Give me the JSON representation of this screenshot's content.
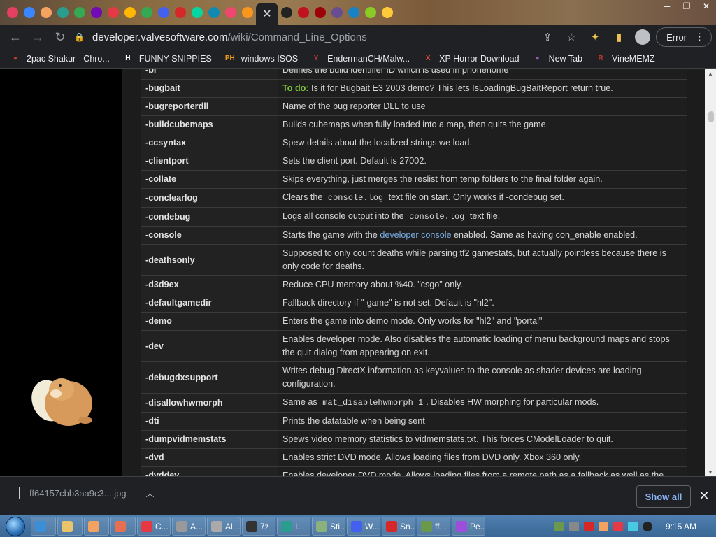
{
  "browser": {
    "tab_favicons": [
      "instagram-icon",
      "tab-icon",
      "tab-icon",
      "tab-icon",
      "chrome-icon",
      "tab-icon",
      "tab-icon",
      "tab-icon",
      "chrome-icon",
      "tab-icon",
      "tab-icon",
      "tab-icon",
      "tab-icon",
      "tab-icon",
      "tab-icon",
      "skull-icon",
      "tab-icon",
      "tab-icon",
      "tab-icon",
      "tab-icon",
      "tab-icon",
      "tab-icon"
    ],
    "active_tab_close": "✕",
    "url_domain": "developer.valvesoftware.com",
    "url_path": "/wiki/Command_Line_Options",
    "error_label": "Error",
    "bookmarks": [
      {
        "label": "2pac Shakur - Chro...",
        "icon": "2pac-icon",
        "color": "#c0392b"
      },
      {
        "label": "FUNNY SNIPPIES",
        "icon": "H",
        "color": "#ffffff"
      },
      {
        "label": "windows ISOS",
        "icon": "PH",
        "color": "#f39c12"
      },
      {
        "label": "EndermanCH/Malw...",
        "icon": "Y",
        "color": "#c0392b"
      },
      {
        "label": "XP Horror Download",
        "icon": "X",
        "color": "#e74c3c"
      },
      {
        "label": "New Tab",
        "icon": "newtab-icon",
        "color": "#9b59b6"
      },
      {
        "label": "VineMEMZ",
        "icon": "R",
        "color": "#c0392b"
      }
    ]
  },
  "commands": [
    {
      "opt": "-bi",
      "parts": [
        {
          "t": "text",
          "v": "Defines the build identifier ID which is used in phonehome"
        }
      ]
    },
    {
      "opt": "-bugbait",
      "parts": [
        {
          "t": "todo",
          "v": "To do:"
        },
        {
          "t": "text",
          "v": " Is it for Bugbait E3 2003 demo? This lets IsLoadingBugBaitReport return true."
        }
      ]
    },
    {
      "opt": "-bugreporterdll",
      "parts": [
        {
          "t": "text",
          "v": "Name of the bug reporter DLL to use"
        }
      ]
    },
    {
      "opt": "-buildcubemaps",
      "parts": [
        {
          "t": "text",
          "v": "Builds cubemaps when fully loaded into a map, then quits the game."
        }
      ]
    },
    {
      "opt": "-ccsyntax",
      "parts": [
        {
          "t": "text",
          "v": "Spew details about the localized strings we load."
        }
      ]
    },
    {
      "opt": "-clientport",
      "parts": [
        {
          "t": "text",
          "v": "Sets the client port. Default is 27002."
        }
      ]
    },
    {
      "opt": "-collate",
      "parts": [
        {
          "t": "text",
          "v": "Skips everything, just merges the reslist from temp folders to the final folder again."
        }
      ]
    },
    {
      "opt": "-conclearlog",
      "parts": [
        {
          "t": "text",
          "v": "Clears the "
        },
        {
          "t": "code",
          "v": "console.log"
        },
        {
          "t": "text",
          "v": " text file on start. Only works if -condebug set."
        }
      ]
    },
    {
      "opt": "-condebug",
      "parts": [
        {
          "t": "text",
          "v": "Logs all console output into the "
        },
        {
          "t": "code",
          "v": "console.log"
        },
        {
          "t": "text",
          "v": " text file."
        }
      ]
    },
    {
      "opt": "-console",
      "parts": [
        {
          "t": "text",
          "v": "Starts the game with the "
        },
        {
          "t": "link",
          "v": "developer console"
        },
        {
          "t": "text",
          "v": " enabled. Same as having con_enable enabled."
        }
      ]
    },
    {
      "opt": "-deathsonly",
      "parts": [
        {
          "t": "text",
          "v": "Supposed to only count deaths while parsing tf2 gamestats, but actually pointless because there is only code for deaths."
        }
      ]
    },
    {
      "opt": "-d3d9ex",
      "parts": [
        {
          "t": "text",
          "v": "Reduce CPU memory about %40. \"csgo\" only."
        }
      ]
    },
    {
      "opt": "-defaultgamedir",
      "parts": [
        {
          "t": "text",
          "v": "Fallback directory if \"-game\" is not set. Default is \"hl2\"."
        }
      ]
    },
    {
      "opt": "-demo",
      "parts": [
        {
          "t": "text",
          "v": "Enters the game into demo mode. Only works for \"hl2\" and \"portal\""
        }
      ]
    },
    {
      "opt": "-dev",
      "parts": [
        {
          "t": "text",
          "v": "Enables developer mode. Also disables the automatic loading of menu background maps and stops the quit dialog from appearing on exit."
        }
      ]
    },
    {
      "opt": "-debugdxsupport",
      "parts": [
        {
          "t": "text",
          "v": "Writes debug DirectX information as keyvalues to the console as shader devices are loading configuration."
        }
      ]
    },
    {
      "opt": "-disallowhwmorph",
      "parts": [
        {
          "t": "text",
          "v": "Same as "
        },
        {
          "t": "code",
          "v": "mat_disablehwmorph 1"
        },
        {
          "t": "text",
          "v": ". Disables HW morphing for particular mods."
        }
      ]
    },
    {
      "opt": "-dti",
      "parts": [
        {
          "t": "text",
          "v": "Prints the datatable when being sent"
        }
      ]
    },
    {
      "opt": "-dumpvidmemstats",
      "parts": [
        {
          "t": "text",
          "v": "Spews video memory statistics to vidmemstats.txt. This forces CModelLoader to quit."
        }
      ]
    },
    {
      "opt": "-dvd",
      "parts": [
        {
          "t": "text",
          "v": "Enables strict DVD mode. Allows loading files from DVD only. Xbox 360 only."
        }
      ]
    },
    {
      "opt": "-dvddev",
      "parts": [
        {
          "t": "text",
          "v": "Enables developer DVD mode. Allows loading files from a remote path as a fallback as well as the"
        }
      ]
    }
  ],
  "download": {
    "filename": "ff64157cbb3aa9c3....jpg",
    "show_all": "Show all"
  },
  "taskbar": {
    "apps": [
      {
        "label": "",
        "color": "#3b8fd8",
        "icon": "ie-icon"
      },
      {
        "label": "",
        "color": "#e9c46a",
        "icon": "folder-icon"
      },
      {
        "label": "",
        "color": "#f4a261",
        "icon": "media-icon"
      },
      {
        "label": "",
        "color": "#e76f51",
        "icon": "app-icon"
      },
      {
        "label": "C...",
        "color": "#e63946",
        "icon": "chrome-icon"
      },
      {
        "label": "A...",
        "color": "#999999",
        "icon": "app-icon"
      },
      {
        "label": "Al...",
        "color": "#aaaaaa",
        "icon": "app-icon"
      },
      {
        "label": "7z",
        "color": "#333333",
        "icon": "7zip-icon"
      },
      {
        "label": "I...",
        "color": "#2a9d8f",
        "icon": "app-icon"
      },
      {
        "label": "Sti...",
        "color": "#8ab17d",
        "icon": "app-icon"
      },
      {
        "label": "W...",
        "color": "#4361ee",
        "icon": "app-icon"
      },
      {
        "label": "Sn...",
        "color": "#d62828",
        "icon": "app-icon"
      },
      {
        "label": "ff...",
        "color": "#6a994e",
        "icon": "app-icon"
      },
      {
        "label": "Pe...",
        "color": "#9d4edd",
        "icon": "app-icon"
      }
    ],
    "clock": "9:15 AM"
  }
}
